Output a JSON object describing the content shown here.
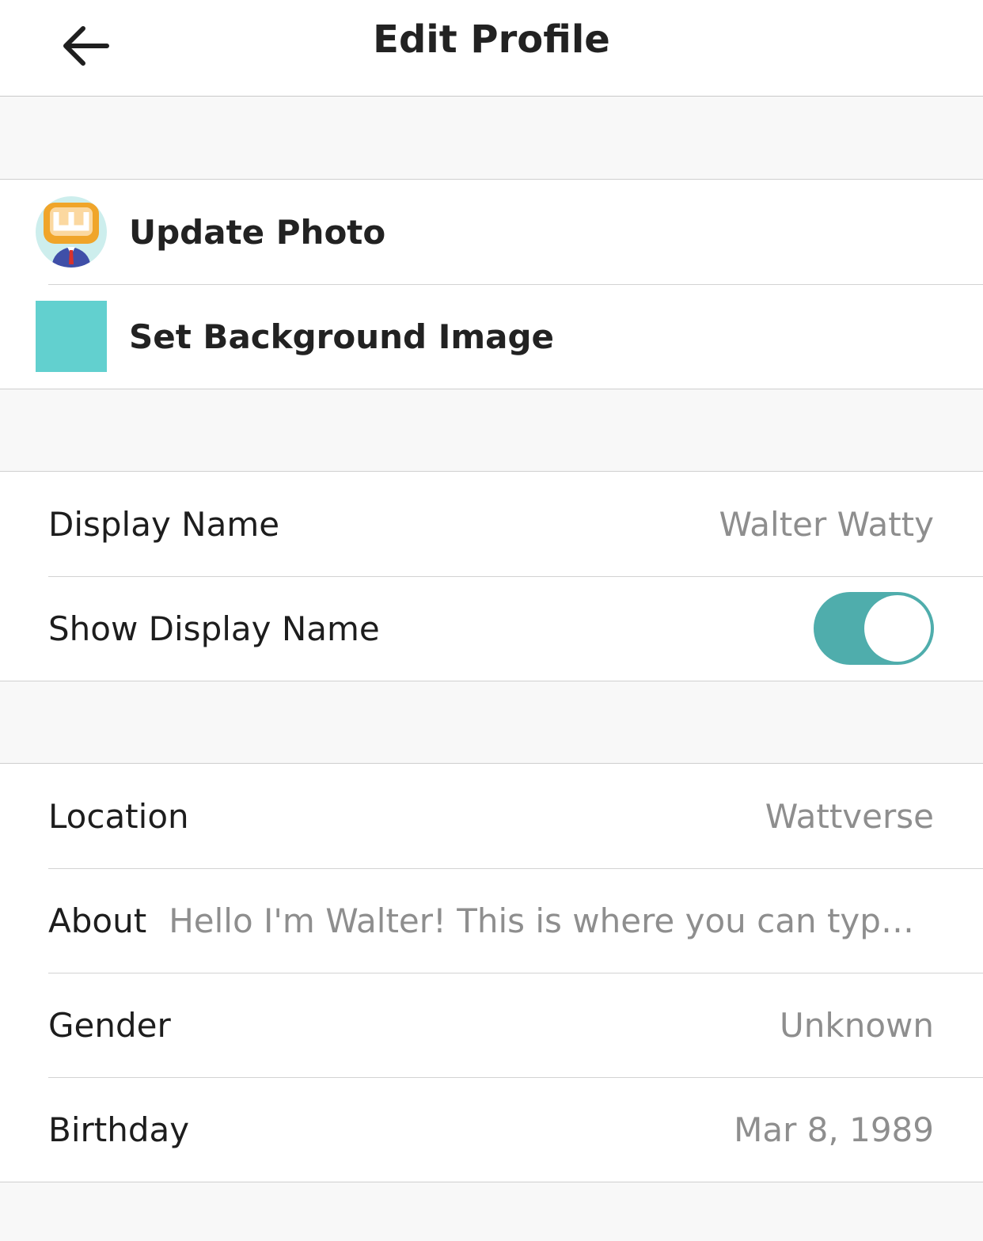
{
  "header": {
    "title": "Edit Profile",
    "back_icon": "arrow-left-icon"
  },
  "media": {
    "update_photo_label": "Update Photo",
    "avatar_icon": "avatar-icon",
    "set_background_label": "Set Background Image",
    "background_color": "#62d0cf"
  },
  "display": {
    "display_name_label": "Display Name",
    "display_name_value": "Walter Watty",
    "show_display_name_label": "Show Display Name",
    "show_display_name_on": true
  },
  "details": {
    "location_label": "Location",
    "location_value": "Wattverse",
    "about_label": "About",
    "about_value": "Hello I'm Walter! This is where you can type ou…",
    "gender_label": "Gender",
    "gender_value": "Unknown",
    "birthday_label": "Birthday",
    "birthday_value": "Mar 8, 1989"
  },
  "colors": {
    "accent": "#4fadac",
    "background": "#f8f8f8"
  }
}
